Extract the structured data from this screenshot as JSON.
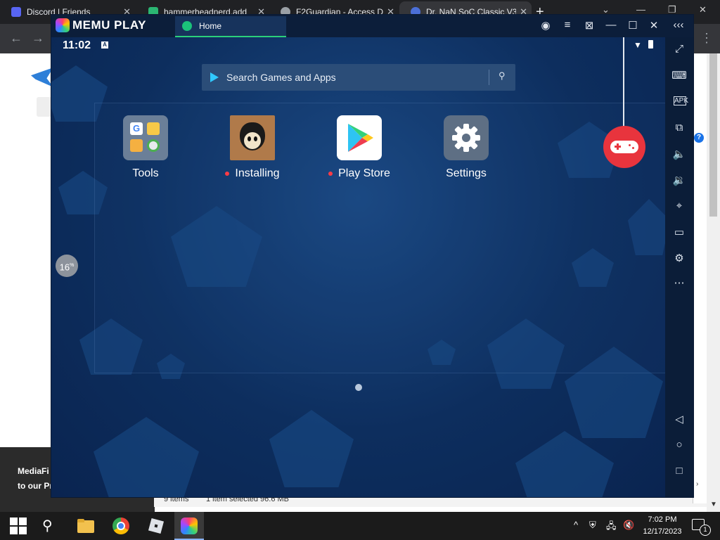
{
  "browser": {
    "tabs": [
      {
        "title": "Discord | Friends",
        "color": "#5865f2"
      },
      {
        "title": "hammerheadnerd.add",
        "color": "#2bb673"
      },
      {
        "title": "F2Guardian - Access D",
        "color": "#9aa0a6"
      },
      {
        "title": "Dr. NaN SoC Classic V3",
        "color": "#4b6fd8"
      }
    ],
    "new_tab": "+"
  },
  "background": {
    "bottom_left_line1": "MediaFi",
    "bottom_left_line2": "to our Pr",
    "explorer": {
      "items": "9 items",
      "selected": "1 item selected  96.6 MB"
    }
  },
  "memu": {
    "app_name": "MEMU PLAY",
    "tab_label": "Home",
    "status": {
      "time": "11:02"
    },
    "search": {
      "placeholder": "Search Games and Apps"
    },
    "apps": [
      {
        "label": "Tools",
        "installing": false
      },
      {
        "label": "Installing",
        "installing": true
      },
      {
        "label": "Play Store",
        "installing": true
      },
      {
        "label": "Settings",
        "installing": false
      }
    ],
    "install_progress": {
      "value": 16,
      "unit": "%"
    },
    "sidebar": [
      "fullscreen-icon",
      "keyboard-icon",
      "apk-icon",
      "multi-window-icon",
      "volume-up-icon",
      "volume-down-icon",
      "location-icon",
      "folder-icon",
      "settings-icon",
      "more-icon",
      "back-icon",
      "home-icon",
      "recents-icon"
    ]
  },
  "taskbar": {
    "time": "7:02 PM",
    "date": "12/17/2023",
    "notification_count": "1"
  },
  "colors": {
    "accent": "#2bd07a",
    "gamepad": "#e8343d",
    "install_dot": "#ff3b45"
  }
}
